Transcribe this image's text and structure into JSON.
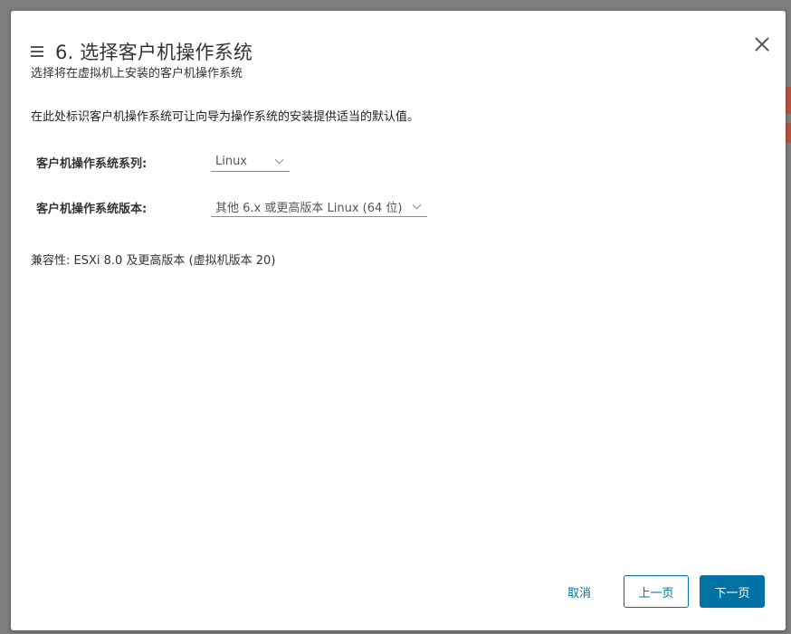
{
  "dialog": {
    "title": "6. 选择客户机操作系统",
    "subtitle": "选择将在虚拟机上安装的客户机操作系统",
    "intro": "在此处标识客户机操作系统可让向导为操作系统的安装提供适当的默认值。"
  },
  "form": {
    "family_label": "客户机操作系统系列:",
    "family_value": "Linux",
    "version_label": "客户机操作系统版本:",
    "version_value": "其他 6.x 或更高版本 Linux (64 位)"
  },
  "compatibility": "兼容性: ESXi 8.0 及更高版本 (虚拟机版本 20)",
  "buttons": {
    "cancel": "取消",
    "back": "上一页",
    "next": "下一页"
  },
  "colors": {
    "accent": "#0072a3",
    "background_accent": "#b2543e"
  },
  "icons": {
    "menu": "menu-icon",
    "close": "close-icon",
    "dropdown": "chevron-down-icon"
  }
}
